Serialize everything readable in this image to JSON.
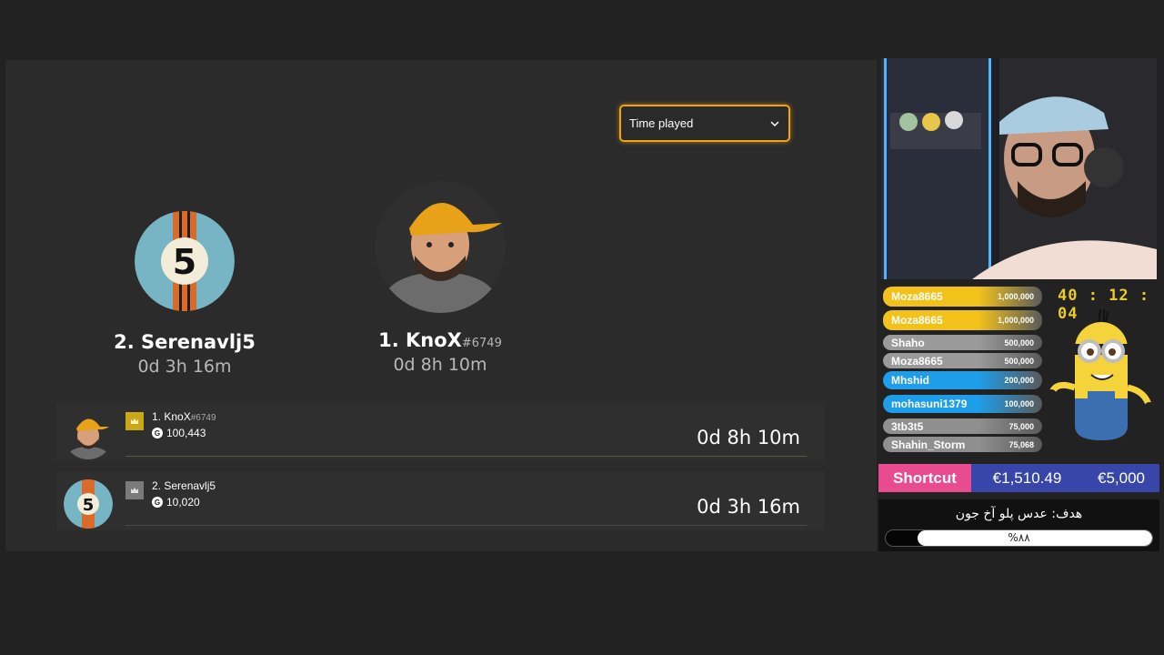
{
  "dropdown": {
    "selected": "Time played"
  },
  "podium": [
    {
      "rank_name": "2. Serenavlj5",
      "tag": "",
      "time": "0d 3h 16m",
      "avatar": "number-5-avatar"
    },
    {
      "rank_name": "1. KnoX",
      "tag": "#6749",
      "time": "0d 8h 10m",
      "avatar": "man-yellow-cap-avatar"
    }
  ],
  "leaderboard": [
    {
      "rank_name": "1. KnoX",
      "tag": "#6749",
      "gamerscore": "100,443",
      "time": "0d 8h 10m"
    },
    {
      "rank_name": "2. Serenavlj5",
      "tag": "",
      "gamerscore": "10,020",
      "time": "0d 3h 16m"
    }
  ],
  "stream_overlay": {
    "timer": "40 : 12 : 04",
    "donors": [
      {
        "name": "Moza8665",
        "amount": "1,000,000",
        "color": "#f2c21b"
      },
      {
        "name": "Moza8665",
        "amount": "1,000,000",
        "color": "#f2c21b"
      },
      {
        "name": "Shaho",
        "amount": "500,000",
        "color": "#9a9a9a"
      },
      {
        "name": "Moza8665",
        "amount": "500,000",
        "color": "#9a9a9a"
      },
      {
        "name": "Mhshid",
        "amount": "200,000",
        "color": "#1e9de8"
      },
      {
        "name": "mohasuni1379",
        "amount": "100,000",
        "color": "#1e9de8"
      },
      {
        "name": "3tb3t5",
        "amount": "75,000",
        "color": "#8f8f8f"
      },
      {
        "name": "Shahin_Storm",
        "amount": "75,068",
        "color": "#8f8f8f"
      }
    ],
    "shortcut": {
      "brand": "Shortcut",
      "raised": "€1,510.49",
      "goal": "€5,000"
    },
    "goal": {
      "title": "هدف: عدس پلو آخ جون",
      "percent_label": "%۸۸",
      "progress": 0.88
    }
  },
  "colors": {
    "accent": "#f2a312",
    "panel": "#2b2b2b"
  }
}
